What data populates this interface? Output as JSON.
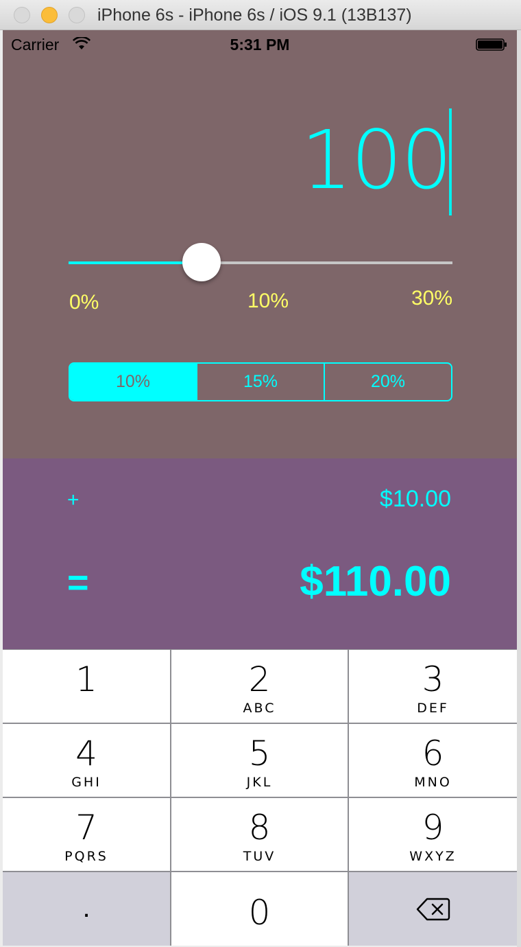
{
  "window": {
    "title": "iPhone 6s - iPhone 6s / iOS 9.1 (13B137)"
  },
  "statusbar": {
    "carrier": "Carrier",
    "time": "5:31 PM",
    "wifi_icon": "wifi-icon",
    "battery_icon": "battery-icon"
  },
  "bill": {
    "amount": "100"
  },
  "slider": {
    "min_label": "0%",
    "mid_label": "10%",
    "max_label": "30%",
    "value_percent": 10,
    "min_value": 0,
    "max_value": 30
  },
  "segments": {
    "items": [
      {
        "label": "10%",
        "selected": true
      },
      {
        "label": "15%",
        "selected": false
      },
      {
        "label": "20%",
        "selected": false
      }
    ]
  },
  "result": {
    "plus": "+",
    "tip": "$10.00",
    "equals": "=",
    "total": "$110.00"
  },
  "keypad": {
    "keys": [
      {
        "digit": "1",
        "letters": ""
      },
      {
        "digit": "2",
        "letters": "ABC"
      },
      {
        "digit": "3",
        "letters": "DEF"
      },
      {
        "digit": "4",
        "letters": "GHI"
      },
      {
        "digit": "5",
        "letters": "JKL"
      },
      {
        "digit": "6",
        "letters": "MNO"
      },
      {
        "digit": "7",
        "letters": "PQRS"
      },
      {
        "digit": "8",
        "letters": "TUV"
      },
      {
        "digit": "9",
        "letters": "WXYZ"
      }
    ],
    "dot": ".",
    "zero": "0",
    "delete_icon": "backspace-icon"
  },
  "colors": {
    "accent": "#00ffff",
    "top_background": "#7e6669",
    "result_background": "#7b5a80",
    "slider_labels": "#ffff66"
  }
}
